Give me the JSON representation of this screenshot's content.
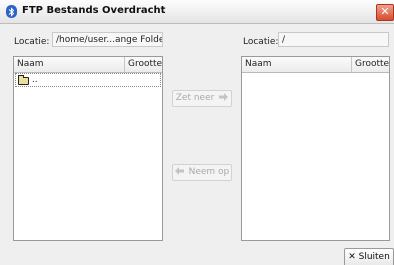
{
  "window": {
    "title": "FTP Bestands Overdracht",
    "close_glyph": "✕"
  },
  "left": {
    "location_label": "Locatie:",
    "location_value": "/home/user...ange Folder",
    "columns": [
      "Naam",
      "Grootte"
    ],
    "rows": [
      {
        "name": "..",
        "size": ""
      }
    ]
  },
  "right": {
    "location_label": "Locatie:",
    "location_value": "/",
    "columns": [
      "Naam",
      "Grootte"
    ],
    "rows": []
  },
  "buttons": {
    "put": {
      "label": "Zet neer",
      "icon": "arrow-right-icon",
      "enabled": false
    },
    "get": {
      "label": "Neem op",
      "icon": "arrow-left-icon",
      "enabled": false
    },
    "close": {
      "label": "Sluiten",
      "icon": "close-icon"
    }
  },
  "colors": {
    "title_icon": "#2b63c9",
    "close_button": "#d94b2e",
    "disabled_text": "#a9a9a9"
  }
}
